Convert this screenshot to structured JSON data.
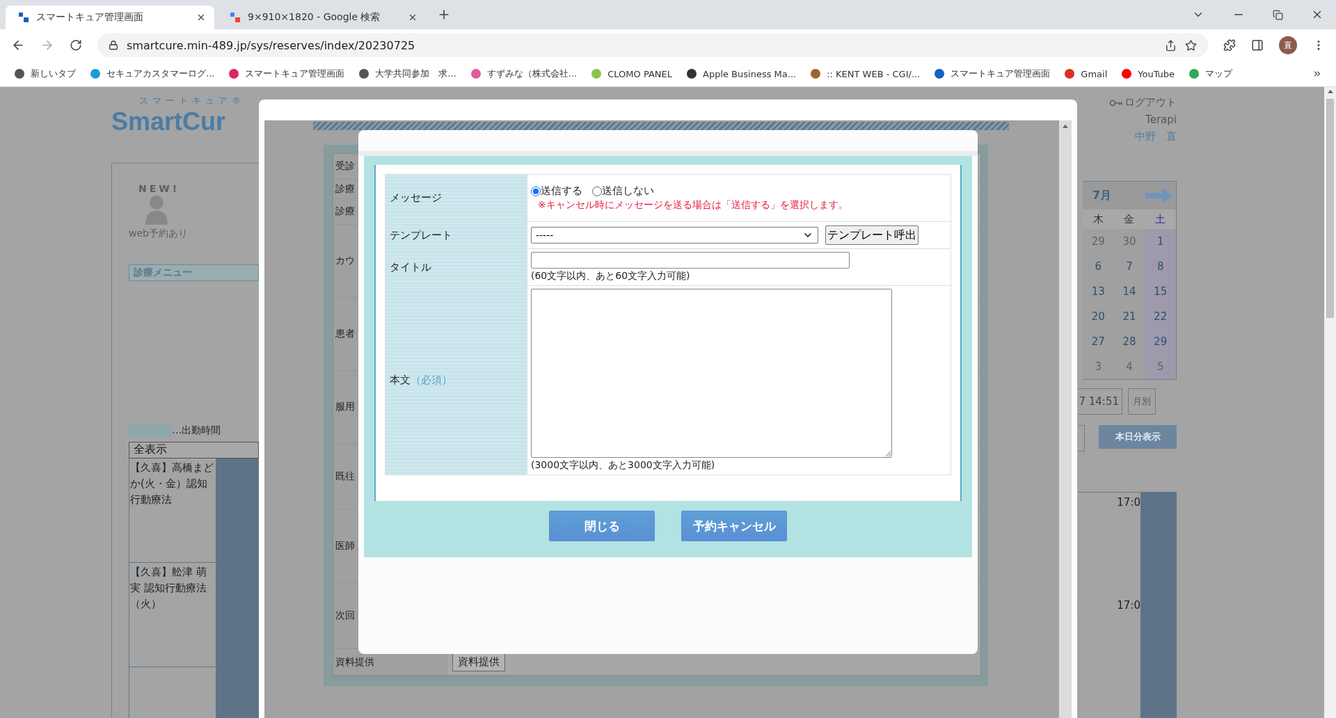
{
  "browser": {
    "tabs": [
      {
        "title": "スマートキュア管理画面",
        "selected": true
      },
      {
        "title": "9×910×1820 - Google 検索",
        "selected": false
      }
    ],
    "url": "smartcure.min-489.jp/sys/reserves/index/20230725",
    "bookmarks": [
      {
        "label": "新しいタブ"
      },
      {
        "label": "セキュアカスタマーログ..."
      },
      {
        "label": "スマートキュア管理画面"
      },
      {
        "label": "大学共同参加　求..."
      },
      {
        "label": "すずみな（株式会社..."
      },
      {
        "label": "CLOMO PANEL"
      },
      {
        "label": "Apple Business Ma..."
      },
      {
        "label": ":: KENT WEB - CGI/..."
      },
      {
        "label": "スマートキュア管理画面"
      },
      {
        "label": "Gmail"
      },
      {
        "label": "YouTube"
      },
      {
        "label": "マップ"
      }
    ],
    "profile": "直"
  },
  "page": {
    "logo_kana": "スマートキュア®",
    "logo_name": "SmartCur",
    "new_badge": "NEW!",
    "web_label": "web予約あり",
    "menu_title": "診療メニュー",
    "legend_label": "…出勤時間",
    "filter": "全表示",
    "list_items": [
      "【久喜】高橋まどか(火・金）認知行動療法",
      "【久喜】舩津 萌実 認知行動療法（火）"
    ],
    "logout": "ログアウト",
    "org": "Terapi",
    "user": "中野　直",
    "calendar": {
      "month": "7月",
      "weekdays": [
        {
          "label": "木",
          "kind": "weekday"
        },
        {
          "label": "金",
          "kind": "weekday"
        },
        {
          "label": "土",
          "kind": "saturday"
        }
      ],
      "weeks": [
        [
          {
            "label": "29",
            "muted": true
          },
          {
            "label": "30",
            "muted": true
          },
          {
            "label": "1",
            "muted": false
          }
        ],
        [
          {
            "label": "6",
            "muted": false
          },
          {
            "label": "7",
            "muted": false
          },
          {
            "label": "8",
            "muted": false
          }
        ],
        [
          {
            "label": "13",
            "muted": false
          },
          {
            "label": "14",
            "muted": false
          },
          {
            "label": "15",
            "muted": false
          }
        ],
        [
          {
            "label": "20",
            "muted": false
          },
          {
            "label": "21",
            "muted": false
          },
          {
            "label": "22",
            "muted": false
          }
        ],
        [
          {
            "label": "27",
            "muted": false
          },
          {
            "label": "28",
            "muted": false
          },
          {
            "label": "29",
            "muted": false
          }
        ],
        [
          {
            "label": "3",
            "muted": true
          },
          {
            "label": "4",
            "muted": true
          },
          {
            "label": "5",
            "muted": true
          }
        ]
      ]
    },
    "time": "7 14:51",
    "monthly_button": "月別",
    "today_button": "本日分表示",
    "schedule_times": [
      "17:0",
      "17:0"
    ]
  },
  "reservation_page": {
    "rows": [
      "受診",
      "診療",
      "診療",
      "カウ",
      "患者",
      "服用",
      "既往",
      "医師",
      "次回"
    ],
    "material_label": "資料提供",
    "material_button": "資料提供"
  },
  "dialog": {
    "message": {
      "label": "メッセージ",
      "options": [
        {
          "label": "送信する",
          "selected": true
        },
        {
          "label": "送信しない",
          "selected": false
        }
      ],
      "note": "※キャンセル時にメッセージを送る場合は「送信する」を選択します。"
    },
    "template": {
      "label": "テンプレート",
      "value": "-----",
      "button": "テンプレート呼出"
    },
    "title": {
      "label": "タイトル",
      "counter": "(60文字以内、あと60文字入力可能)"
    },
    "body": {
      "label": "本文",
      "required": "（必須）",
      "counter": "(3000文字以内、あと3000文字入力可能)"
    },
    "buttons": [
      "閉じる",
      "予約キャンセル"
    ]
  }
}
